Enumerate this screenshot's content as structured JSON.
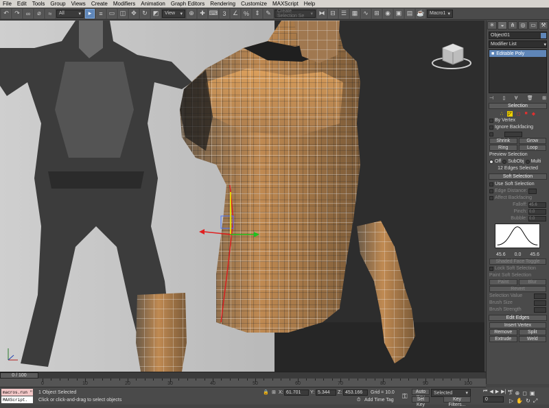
{
  "menu": [
    "File",
    "Edit",
    "Tools",
    "Group",
    "Views",
    "Create",
    "Modifiers",
    "Animation",
    "Graph Editors",
    "Rendering",
    "Customize",
    "MAXScript",
    "Help"
  ],
  "toolbar": {
    "selection_filter": "All",
    "view_dropdown": "View",
    "selection_set_placeholder": "Create Selection Se",
    "macro_label": "Macro1"
  },
  "command_panel": {
    "object_name": "Object01",
    "modifier_list": "Modifier List",
    "stack_item": "Editable Poly",
    "selection": {
      "header": "Selection",
      "by_vertex": "By Vertex",
      "ignore_backfacing": "Ignore Backfacing",
      "shrink": "Shrink",
      "grow": "Grow",
      "ring": "Ring",
      "loop": "Loop",
      "preview_selection": "Preview Selection",
      "preview_off": "Off",
      "preview_subobj": "SubObj",
      "preview_multi": "Multi",
      "selected_count": "12 Edges Selected"
    },
    "soft_selection": {
      "header": "Soft Selection",
      "use_soft_selection": "Use Soft Selection",
      "edge_distance": "Edge Distance:",
      "affect_backfacing": "Affect Backfacing",
      "falloff_label": "Falloff:",
      "falloff_value": "45.6",
      "pinch_label": "Pinch:",
      "pinch_value": "0.0",
      "bubble_label": "Bubble:",
      "bubble_value": "0.0",
      "curve_left": "45.6",
      "curve_mid": "0.0",
      "curve_right": "45.6",
      "shaded_face_toggle": "Shaded Face Toggle",
      "lock_soft_selection": "Lock Soft Selection",
      "paint_soft_selection": "Paint Soft Selection",
      "paint": "Paint",
      "blur": "Blur",
      "revert": "Revert",
      "selection_value": "Selection Value",
      "brush_size": "Brush Size",
      "brush_strength": "Brush Strength"
    },
    "edit_edges": {
      "header": "Edit Edges",
      "insert_vertex": "Insert Vertex",
      "remove": "Remove",
      "split": "Split",
      "extrude": "Extrude",
      "weld": "Weld"
    }
  },
  "timeline": {
    "frame_display": "0 / 100",
    "ticks": [
      "0",
      "10",
      "20",
      "30",
      "40",
      "50",
      "60",
      "70",
      "80",
      "90",
      "100"
    ]
  },
  "status": {
    "listener_line1": "macros.run \"",
    "listener_line2": "MAXScript.",
    "selected": "1 Object Selected",
    "prompt": "Click or click-and-drag to select objects",
    "x_label": "X:",
    "x_value": "61.701",
    "y_label": "Y:",
    "y_value": "5.344",
    "z_label": "Z:",
    "z_value": "453.166",
    "grid": "Grid = 10.0",
    "add_time_tag": "Add Time Tag",
    "auto_key": "Auto Key",
    "auto_key_value": "Selected",
    "set_key": "Set Key",
    "key_filters": "Key Filters...",
    "frame_value": "0"
  },
  "colors": {
    "menubar": "#d6d3ce",
    "panel": "#4a4a4a",
    "accent": "#5f86b8",
    "mesh": "#c08a52",
    "auto_key_red": "#b03030"
  }
}
